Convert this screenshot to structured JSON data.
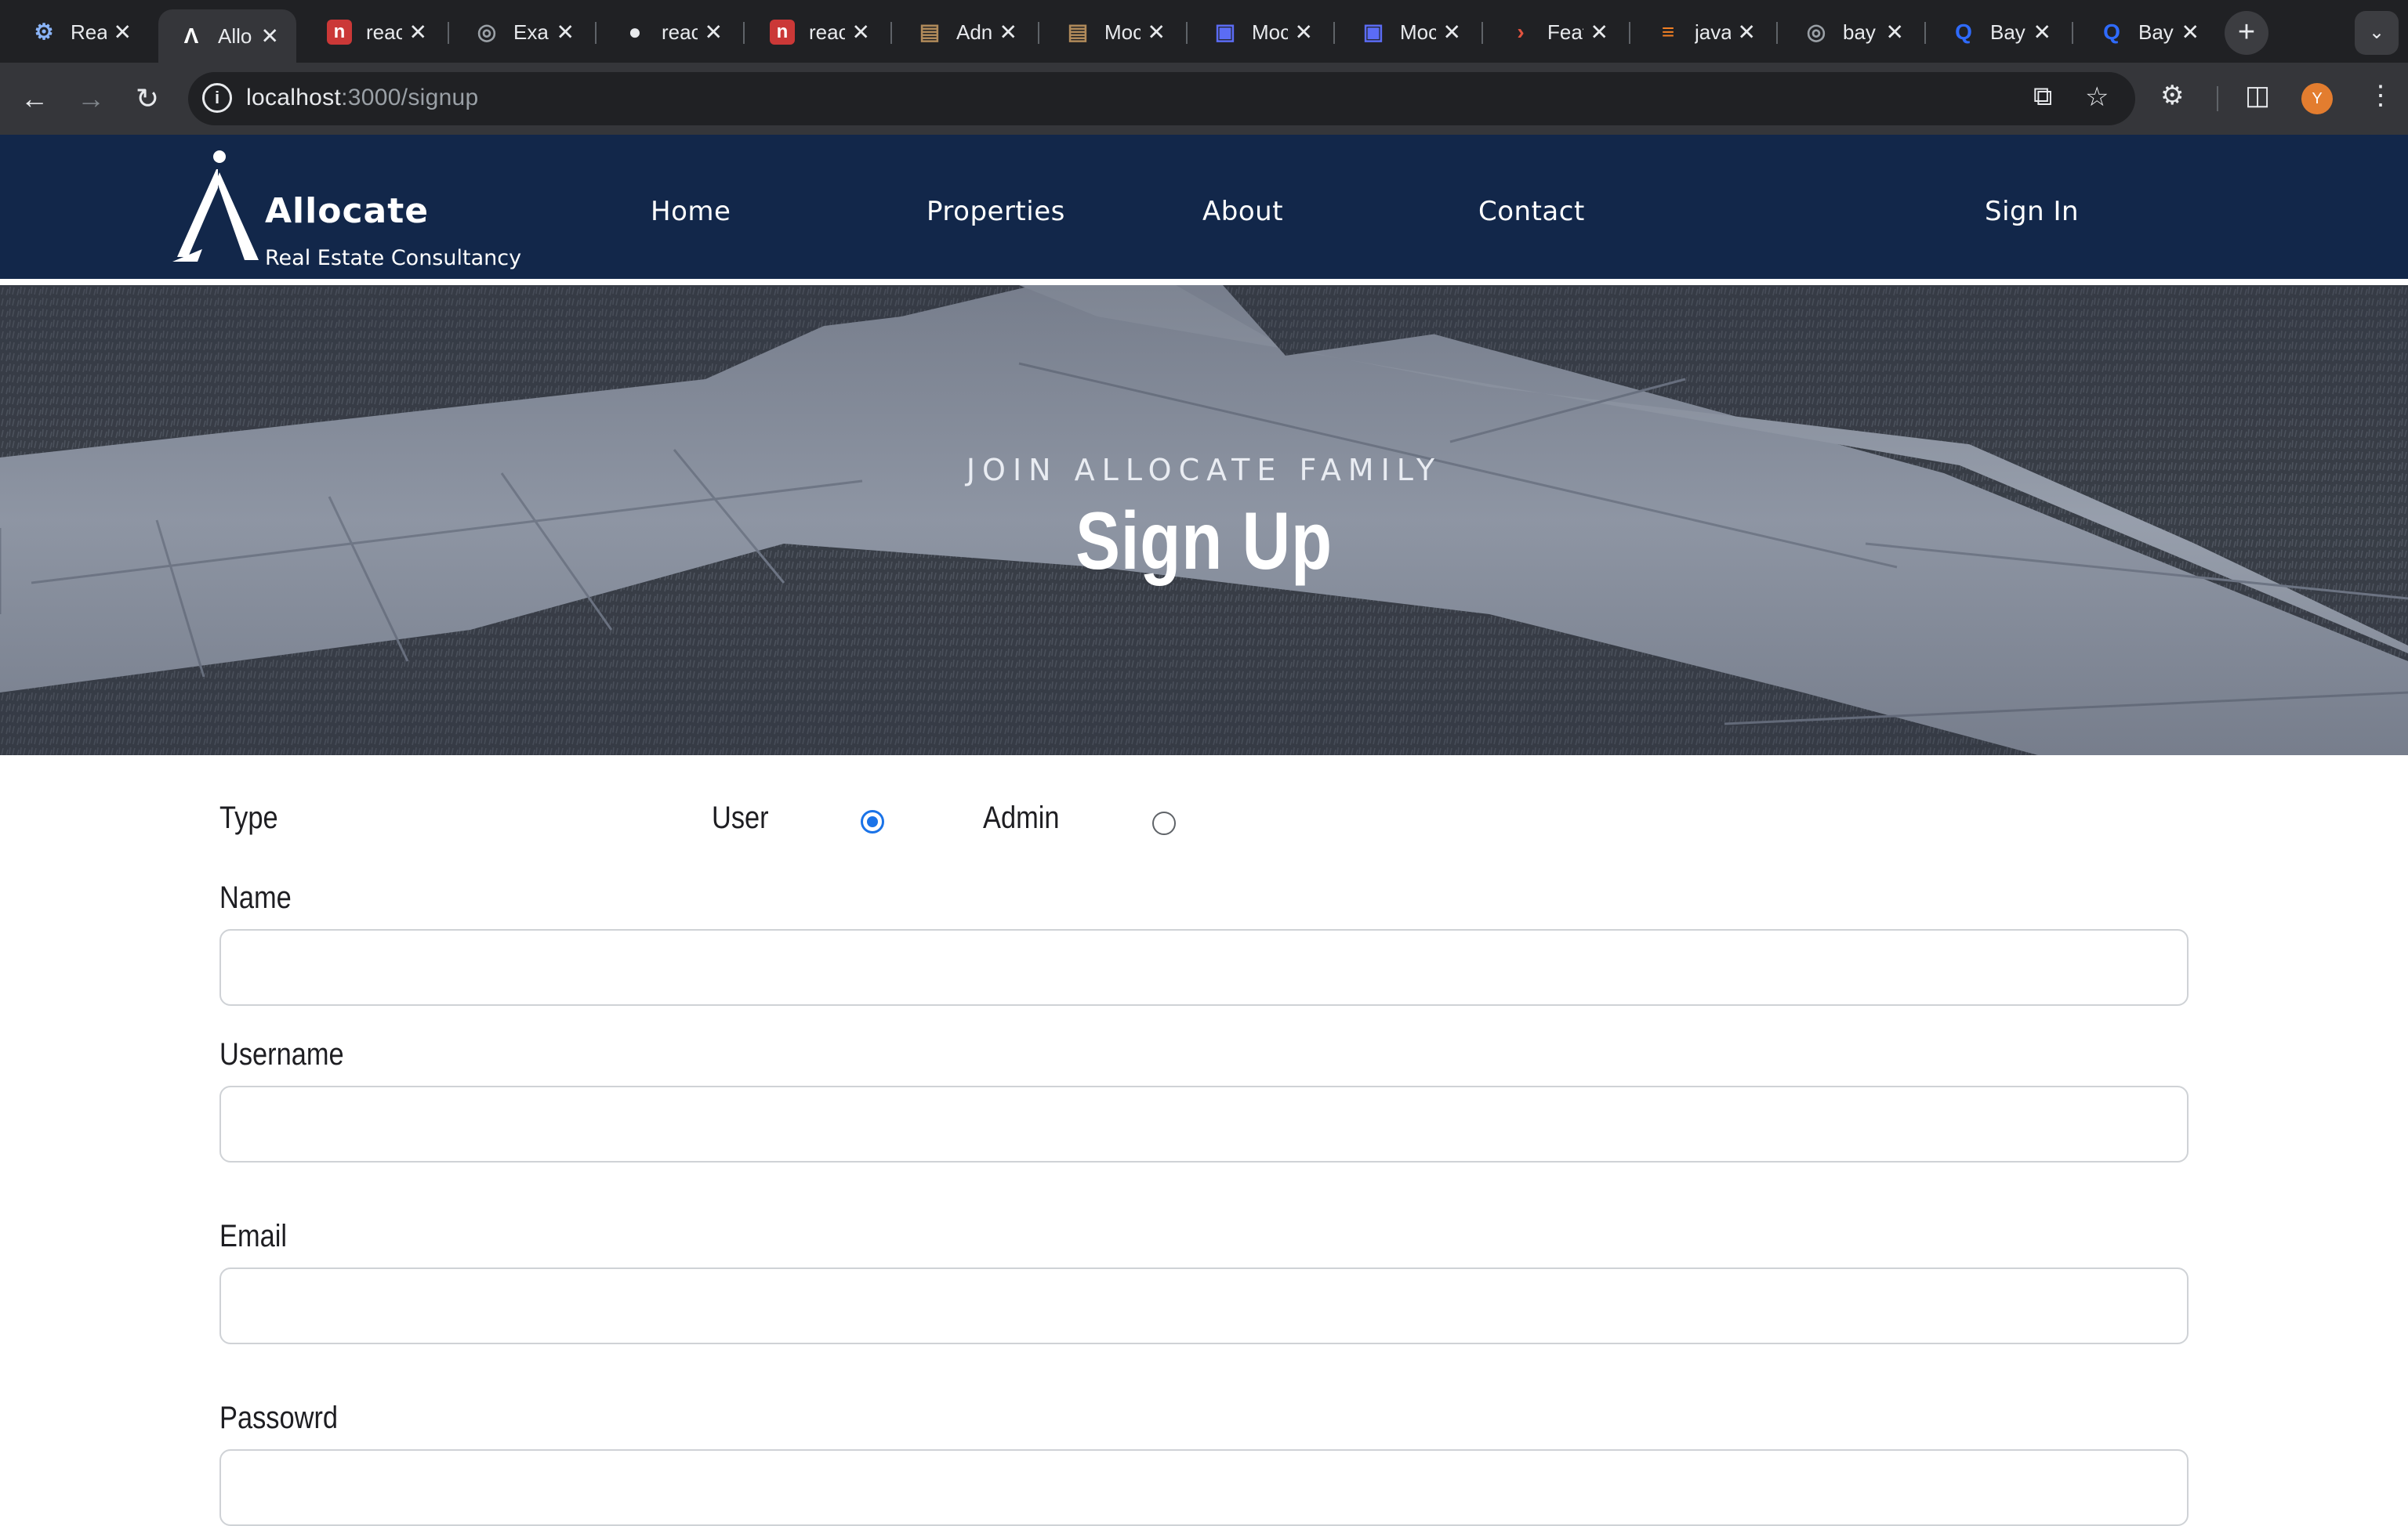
{
  "browser": {
    "tabs": [
      {
        "title": "Rea",
        "favicon": "gear-globe-icon",
        "color": "#8ab4f8"
      },
      {
        "title": "Allo",
        "favicon": "allocate-logo-icon",
        "color": "#ffffff",
        "active": true
      },
      {
        "title": "reac",
        "favicon": "npm-icon",
        "color": "#cb3837"
      },
      {
        "title": "Exa",
        "favicon": "globe-icon",
        "color": "#9aa0a6"
      },
      {
        "title": "reac",
        "favicon": "github-icon",
        "color": "#e8eaed"
      },
      {
        "title": "reac",
        "favicon": "npm-icon",
        "color": "#cb3837"
      },
      {
        "title": "Adn",
        "favicon": "bookmark-doc-icon",
        "color": "#b08a5a"
      },
      {
        "title": "Moc",
        "favicon": "bookmark-doc-icon",
        "color": "#b08a5a"
      },
      {
        "title": "Moc",
        "favicon": "book-icon",
        "color": "#5b6cf5"
      },
      {
        "title": "Moc",
        "favicon": "book-icon",
        "color": "#5b6cf5"
      },
      {
        "title": "Feat",
        "favicon": "chevron-right-icon",
        "color": "#e2533f"
      },
      {
        "title": "java",
        "favicon": "stackoverflow-icon",
        "color": "#f48024"
      },
      {
        "title": "bay",
        "favicon": "globe-icon",
        "color": "#9aa0a6"
      },
      {
        "title": "Bay",
        "favicon": "q-logo-icon",
        "color": "#2f6bff"
      },
      {
        "title": "Bay",
        "favicon": "q-logo-icon",
        "color": "#2f6bff"
      }
    ],
    "url_host": "localhost",
    "url_path": ":3000/signup",
    "profile_initial": "Y",
    "profile_color": "#e37d2f"
  },
  "site": {
    "brand_name": "Allocate",
    "brand_tagline": "Real Estate Consultancy",
    "nav": {
      "home": "Home",
      "properties": "Properties",
      "about": "About",
      "contact": "Contact",
      "sign_in": "Sign In"
    },
    "header_color": "#12274a"
  },
  "hero": {
    "subtitle": "JOIN ALLOCATE FAMILY",
    "title": "Sign Up"
  },
  "form": {
    "type_label": "Type",
    "user_label": "User",
    "admin_label": "Admin",
    "selected_type": "User",
    "name_label": "Name",
    "name_value": "",
    "username_label": "Username",
    "username_value": "",
    "email_label": "Email",
    "email_value": "",
    "password_label": "Passowrd",
    "password_value": ""
  }
}
